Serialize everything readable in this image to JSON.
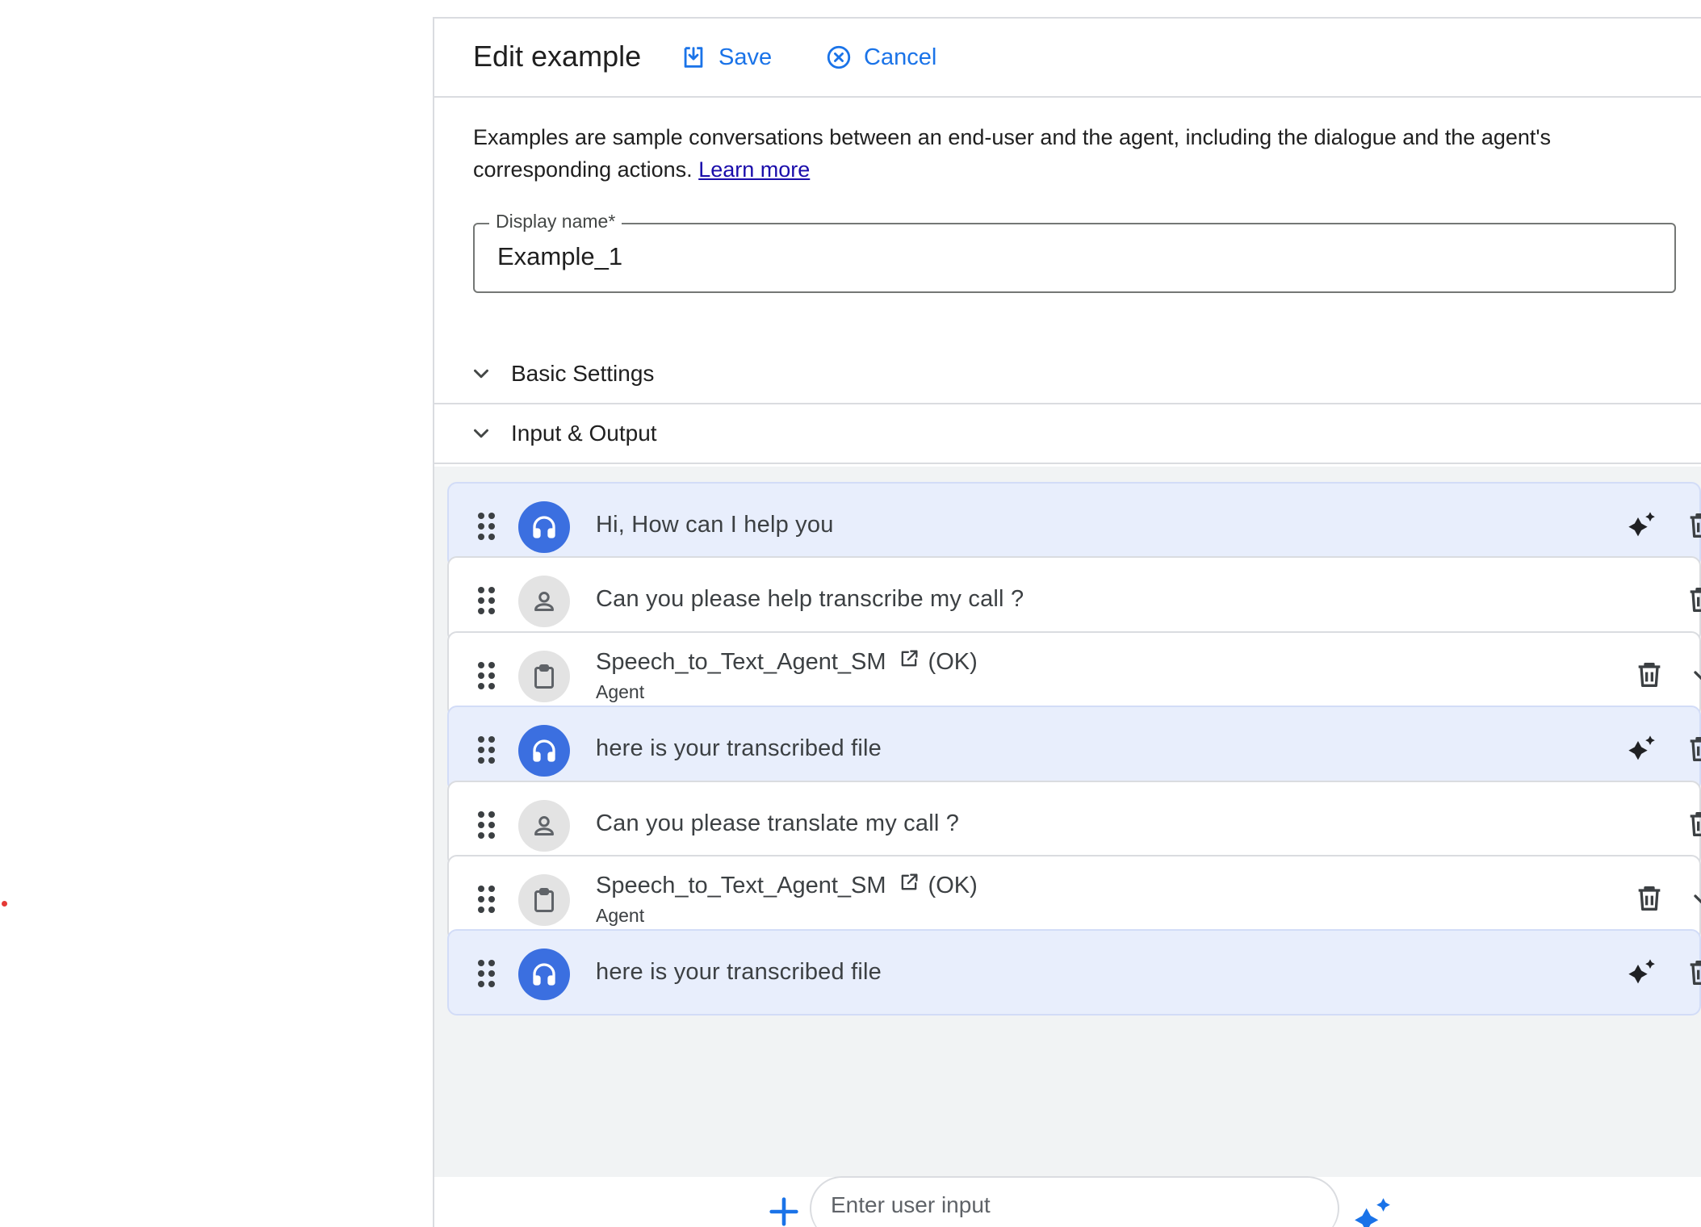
{
  "header": {
    "title": "Edit example",
    "save_label": "Save",
    "cancel_label": "Cancel"
  },
  "description": {
    "text": "Examples are sample conversations between an end-user and the agent, including the dialogue and the agent's corresponding actions.",
    "link_label": "Learn more"
  },
  "display_name": {
    "label": "Display name*",
    "value": "Example_1"
  },
  "sections": {
    "basic_settings": "Basic Settings",
    "input_output": "Input & Output"
  },
  "conversation": [
    {
      "role": "agent",
      "text": "Hi, How can I help you"
    },
    {
      "role": "user",
      "text": "Can you please help transcribe my call ?"
    },
    {
      "role": "tool",
      "name": "Speech_to_Text_Agent_SM",
      "status": "(OK)",
      "sub": "Agent"
    },
    {
      "role": "agent",
      "text": "here is your transcribed file"
    },
    {
      "role": "user",
      "text": "Can you please translate my call ?"
    },
    {
      "role": "tool",
      "name": "Speech_to_Text_Agent_SM",
      "status": "(OK)",
      "sub": "Agent"
    },
    {
      "role": "agent",
      "text": "here is your transcribed file"
    }
  ],
  "footer": {
    "input_placeholder": "Enter user input"
  },
  "colors": {
    "accent": "#1a73e8",
    "agent_card_bg": "#e8eefc",
    "agent_avatar": "#3b6fe0",
    "user_avatar": "#e3e3e3"
  },
  "icons": [
    "save-icon",
    "cancel-icon",
    "chevron-down-icon",
    "drag-handle-icon",
    "headset-icon",
    "person-icon",
    "clipboard-icon",
    "open-external-icon",
    "sparkle-icon",
    "delete-icon",
    "add-icon"
  ]
}
